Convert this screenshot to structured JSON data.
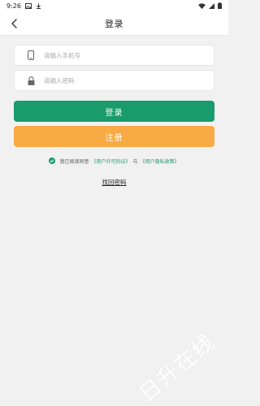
{
  "status_bar": {
    "time": "9:26"
  },
  "header": {
    "title": "登录"
  },
  "form": {
    "phone_placeholder": "请输入手机号",
    "password_placeholder": "请输入密码"
  },
  "buttons": {
    "login_label": "登录",
    "register_label": "注册"
  },
  "agreement": {
    "prefix": "我已阅读同意",
    "user_agreement": "《用户许可协议》",
    "conjunction": "与",
    "privacy_policy": "《用户隐私政策》"
  },
  "forgot_password": "找回密码",
  "watermark": "日升在线",
  "colors": {
    "primary": "#1a9b6e",
    "register": "#f8ab45",
    "background": "#f1f1f1"
  },
  "icons": {
    "back": "chevron-left-icon",
    "phone": "phone-icon",
    "password": "lock-icon",
    "agree": "check-circle-icon"
  }
}
